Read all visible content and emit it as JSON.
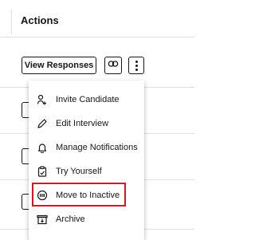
{
  "header": {
    "title": "Actions"
  },
  "row": {
    "view_responses_label": "View Responses"
  },
  "menu": {
    "items": [
      {
        "label": "Invite Candidate",
        "icon": "user-plus-icon"
      },
      {
        "label": "Edit Interview",
        "icon": "pencil-icon"
      },
      {
        "label": "Manage Notifications",
        "icon": "bell-icon"
      },
      {
        "label": "Try Yourself",
        "icon": "clipboard-icon"
      },
      {
        "label": "Move to Inactive",
        "icon": "inactive-icon",
        "highlighted": true
      },
      {
        "label": "Archive",
        "icon": "archive-icon"
      }
    ]
  },
  "colors": {
    "highlight": "#e0101c",
    "text": "#161616",
    "border": "#e0e0e0"
  }
}
